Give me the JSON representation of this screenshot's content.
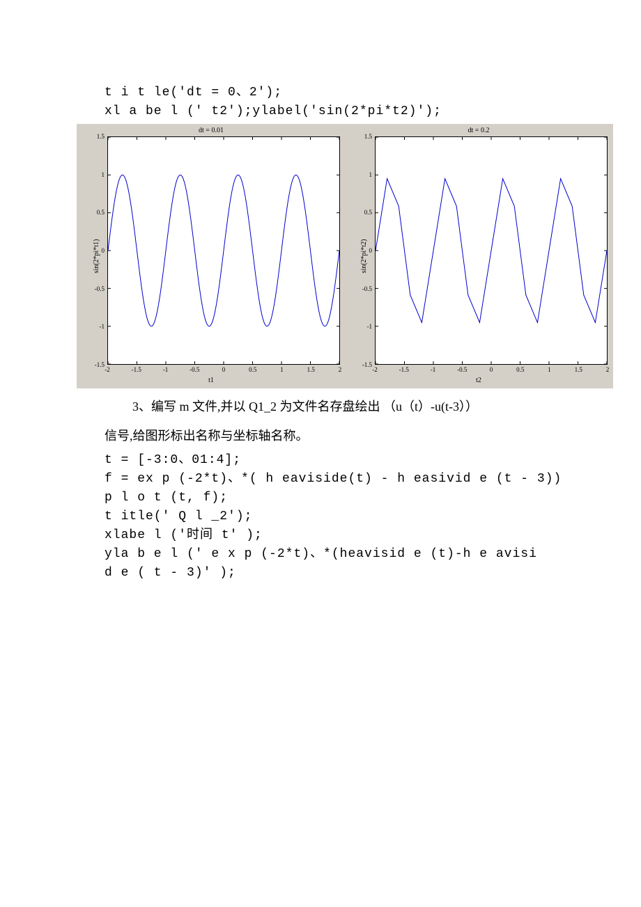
{
  "code_top": {
    "line1": "t i t le('dt = 0、2');",
    "line2": "xl a be l (' t2');ylabel('sin(2*pi*t2)');"
  },
  "text_mid": {
    "line1": "3、编写 m 文件,并以 Q1_2 为文件名存盘绘出 （u（t）-u(t-3））",
    "line2": "信号,给图形标出名称与坐标轴名称。"
  },
  "code_bot": {
    "line1": "t = [-3:0、01:4];",
    "line2": "f = ex p (-2*t)、*( h eaviside(t) - h easivid e (t - 3))",
    "line3": "p l o t (t, f);",
    "line4": "t itle(' Q l _2');",
    "line5": "xlabe l ('时间 t' );",
    "line6": "yla b e l (' e x p (-2*t)、*(heavisid e (t)-h e avisi",
    "line7": "d e ( t - 3)' );"
  },
  "chart_data": [
    {
      "type": "line",
      "title": "dt = 0.01",
      "xlabel": "t1",
      "ylabel": "sin(2*pi*t1)",
      "xlim": [
        -2,
        2
      ],
      "ylim": [
        -1.5,
        1.5
      ],
      "xticks": [
        -2,
        -1.5,
        -1,
        -0.5,
        0,
        0.5,
        1,
        1.5,
        2
      ],
      "yticks": [
        -1.5,
        -1,
        -0.5,
        0,
        0.5,
        1,
        1.5
      ],
      "description": "y = sin(2*pi*t) sampled at dt=0.01, smooth sine over t in [-2,2]"
    },
    {
      "type": "line",
      "title": "dt = 0.2",
      "xlabel": "t2",
      "ylabel": "sin(2*pi*t2)",
      "xlim": [
        -2,
        2
      ],
      "ylim": [
        -1.5,
        1.5
      ],
      "xticks": [
        -2,
        -1.5,
        -1,
        -0.5,
        0,
        0.5,
        1,
        1.5,
        2
      ],
      "yticks": [
        -1.5,
        -1,
        -0.5,
        0,
        0.5,
        1,
        1.5
      ],
      "description": "y = sin(2*pi*t) sampled at dt=0.2, piecewise-linear (triangular-looking) over t in [-2,2]"
    }
  ]
}
